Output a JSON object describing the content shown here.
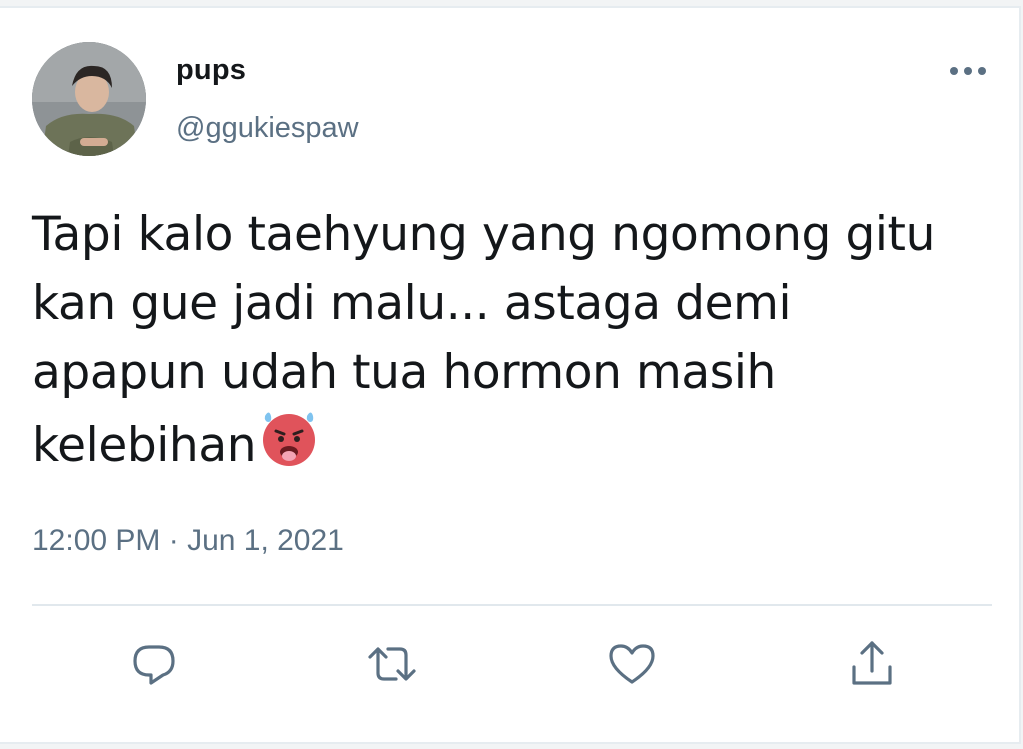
{
  "tweet": {
    "author": {
      "display_name": "pups",
      "handle": "@ggukiespaw"
    },
    "text_lines": [
      "Tapi kalo taehyung yang ngomong gitu",
      "kan gue jadi malu... astaga demi",
      "apapun udah tua hormon masih",
      "kelebihan"
    ],
    "emoji": "hot-face-emoji-icon",
    "timestamp": "12:00 PM · Jun 1, 2021"
  },
  "actions": {
    "reply": "speech-bubble-icon",
    "retweet": "retweet-arrows-icon",
    "like": "heart-icon",
    "share": "share-upload-icon"
  },
  "colors": {
    "text_primary": "#14171a",
    "text_secondary": "#5b7083",
    "icon": "#5b7083",
    "divider": "#e1e8ed",
    "emoji_face": "#e0535b"
  }
}
